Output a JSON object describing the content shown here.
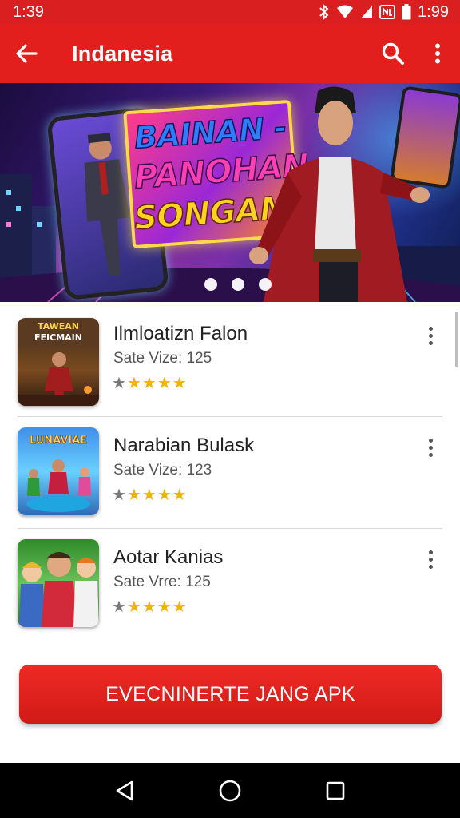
{
  "status_bar": {
    "time_left": "1:39",
    "time_right": "1:99",
    "icons": [
      "bluetooth-icon",
      "wifi-icon",
      "signal-icon",
      "nfc-icon",
      "battery-icon"
    ]
  },
  "app_bar": {
    "title": "Indanesia",
    "icons": [
      "back-arrow-icon",
      "search-icon",
      "more-vert-icon"
    ]
  },
  "banner": {
    "headline_line1": "BAINAN -",
    "headline_line2": "PANOHAN",
    "headline_line3": "SONGAM",
    "page_count": 3,
    "active_page": 1
  },
  "apps": [
    {
      "name": "Ilmloatizn Falon",
      "meta": "Sate Vize: 125",
      "rating": 4,
      "max_rating": 5,
      "icon_caption_1": "TAWEAN",
      "icon_caption_2": "FEICMAIN"
    },
    {
      "name": "Narabian Bulask",
      "meta": "Sate Vize: 123",
      "rating": 4,
      "max_rating": 5,
      "icon_caption_1": "LUNAVIAE",
      "icon_caption_2": ""
    },
    {
      "name": "Aotar Kanias",
      "meta": "Sate Vrre: 125",
      "rating": 4,
      "max_rating": 5,
      "icon_caption_1": "",
      "icon_caption_2": ""
    }
  ],
  "cta": {
    "label": "EVECNINERTE JANG APK"
  },
  "nav_bar": {
    "icons": [
      "back-triangle-icon",
      "home-circle-icon",
      "recents-square-icon"
    ]
  },
  "colors": {
    "brand_red": "#e21f1c",
    "status_red": "#d91f1f",
    "star_gold": "#f0b400",
    "star_gray": "#777777"
  }
}
